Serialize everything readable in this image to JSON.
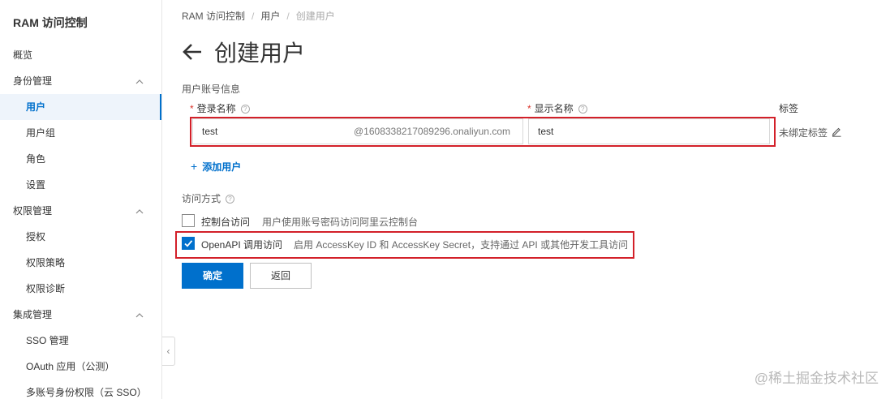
{
  "sidebar": {
    "title": "RAM 访问控制",
    "items": [
      {
        "label": "概览"
      },
      {
        "label": "身份管理"
      },
      {
        "label": "用户"
      },
      {
        "label": "用户组"
      },
      {
        "label": "角色"
      },
      {
        "label": "设置"
      },
      {
        "label": "权限管理"
      },
      {
        "label": "授权"
      },
      {
        "label": "权限策略"
      },
      {
        "label": "权限诊断"
      },
      {
        "label": "集成管理"
      },
      {
        "label": "SSO 管理"
      },
      {
        "label": "OAuth 应用（公测）"
      },
      {
        "label": "多账号身份权限（云 SSO）"
      }
    ],
    "collapse_glyph": "‹"
  },
  "breadcrumb": {
    "items": [
      "RAM 访问控制",
      "用户",
      "创建用户"
    ],
    "separator": "/"
  },
  "page": {
    "title": "创建用户"
  },
  "form": {
    "section_account": "用户账号信息",
    "login_name_label": "登录名称",
    "login_name_value": "test",
    "login_name_suffix": "@1608338217089296.onaliyun.com",
    "display_name_label": "显示名称",
    "display_name_value": "test",
    "tag_label": "标签",
    "tag_value": "未绑定标签",
    "required_mark": "*",
    "help_glyph": "?",
    "add_user_plus": "+",
    "add_user_label": "添加用户",
    "section_access": "访问方式",
    "console_access_label": "控制台访问",
    "console_access_desc": "用户使用账号密码访问阿里云控制台",
    "console_access_checked": false,
    "openapi_access_label": "OpenAPI 调用访问",
    "openapi_access_desc": "启用 AccessKey ID 和 AccessKey Secret，支持通过 API 或其他开发工具访问",
    "openapi_access_checked": true,
    "confirm_label": "确定",
    "back_label": "返回"
  },
  "watermark": "@稀土掘金技术社区",
  "colors": {
    "primary": "#0070cc",
    "highlight": "#d32029"
  }
}
